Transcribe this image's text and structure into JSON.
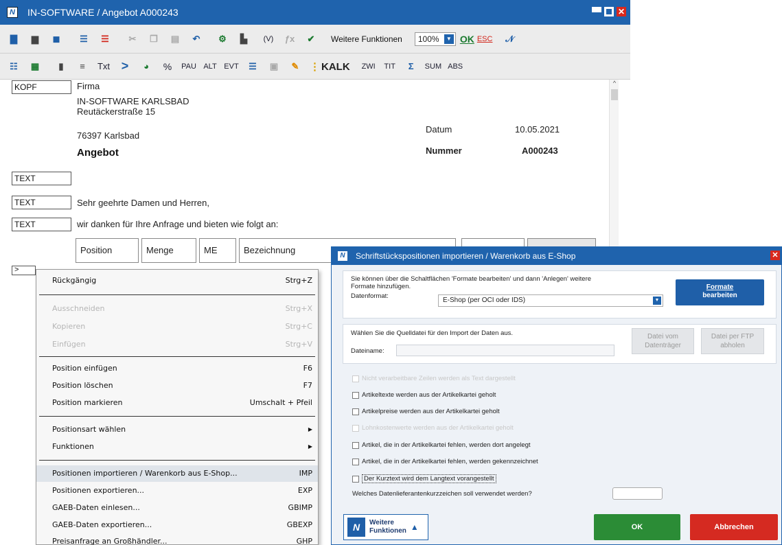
{
  "window": {
    "title": "IN-SOFTWARE / Angebot A000243",
    "icon": "app-logo-icon"
  },
  "toolbar1": {
    "weitere_funktionen": "Weitere Funktionen",
    "zoom": "100%",
    "ok": "OK",
    "esc": "ESC",
    "v_label": "(V)"
  },
  "toolbar2": {
    "txt": "Txt",
    "gt": ">",
    "percent": "%",
    "pau": "PAU",
    "alt": "ALT",
    "evt": "EVT",
    "kalk": "KALK",
    "zwi": "ZWI",
    "tit": "TIT",
    "sum": "SUM",
    "abs": "ABS"
  },
  "document": {
    "kopf_label": "KOPF",
    "firma": "Firma",
    "company": "IN-SOFTWARE KARLSBAD",
    "street": "Reutäckerstraße 15",
    "city": "76397 Karlsbad",
    "datum_label": "Datum",
    "datum_value": "10.05.2021",
    "title": "Angebot",
    "nummer_label": "Nummer",
    "nummer_value": "A000243",
    "text_label": "TEXT",
    "greeting": "Sehr geehrte Damen und Herren,",
    "intro": "wir danken für Ihre Anfrage und bieten wie folgt an:",
    "columns": [
      "Position",
      "Menge",
      "ME",
      "Bezeichnung"
    ],
    "pos_marker": ">"
  },
  "context_menu": {
    "items": [
      {
        "label": "Rückgängig",
        "shortcut": "Strg+Z",
        "disabled": false
      },
      {
        "label": "Ausschneiden",
        "shortcut": "Strg+X",
        "disabled": true
      },
      {
        "label": "Kopieren",
        "shortcut": "Strg+C",
        "disabled": true
      },
      {
        "label": "Einfügen",
        "shortcut": "Strg+V",
        "disabled": true
      },
      {
        "label": "Position einfügen",
        "shortcut": "F6",
        "disabled": false
      },
      {
        "label": "Position löschen",
        "shortcut": "F7",
        "disabled": false
      },
      {
        "label": "Position markieren",
        "shortcut": "Umschalt + Pfeil",
        "disabled": false
      },
      {
        "label": "Positionsart wählen",
        "shortcut": "",
        "disabled": false
      },
      {
        "label": "Funktionen",
        "shortcut": "",
        "disabled": false
      },
      {
        "label": "Positionen importieren / Warenkorb aus E-Shop...",
        "shortcut": "IMP",
        "disabled": false
      },
      {
        "label": "Positionen exportieren...",
        "shortcut": "EXP",
        "disabled": false
      },
      {
        "label": "GAEB-Daten einlesen...",
        "shortcut": "GBIMP",
        "disabled": false
      },
      {
        "label": "GAEB-Daten exportieren...",
        "shortcut": "GBEXP",
        "disabled": false
      },
      {
        "label": "Preisanfrage an Großhändler...",
        "shortcut": "GHP",
        "disabled": false
      }
    ]
  },
  "dialog": {
    "title": "Schriftstückspositionen importieren / Warenkorb aus E-Shop",
    "intro_line1": "Sie können über die Schaltflächen 'Formate bearbeiten' und dann 'Anlegen' weitere",
    "intro_line2": "Formate hinzufügen.",
    "datenformat_label": "Datenformat:",
    "datenformat_value": "E-Shop (per OCI oder IDS)",
    "formate_btn_line1": "Formate",
    "formate_btn_line2": "bearbeiten",
    "quelldatei_text": "Wählen Sie die Quelldatei für den Import der Daten aus.",
    "dateiname_label": "Dateiname:",
    "btn_datentraeger_line1": "Datei vom",
    "btn_datentraeger_line2": "Datenträger",
    "btn_ftp_line1": "Datei per FTP",
    "btn_ftp_line2": "abholen",
    "checkboxes": [
      {
        "label": "Nicht verarbeitbare Zeilen werden als Text dargestellt",
        "disabled": true
      },
      {
        "label": "Artikeltexte werden aus der Artikelkartei geholt",
        "disabled": false
      },
      {
        "label": "Artikelpreise werden aus der Artikelkartei geholt",
        "disabled": false
      },
      {
        "label": "Lohnkostenwerte werden aus der Artikelkartei geholt",
        "disabled": true
      },
      {
        "label": "Artikel, die in der Artikelkartei fehlen, werden dort angelegt",
        "disabled": false
      },
      {
        "label": "Artikel, die in der Artikelkartei fehlen, werden gekennzeichnet",
        "disabled": false
      },
      {
        "label": "Der Kurztext wird dem Langtext vorangestellt",
        "disabled": false
      }
    ],
    "kurzzeichen_question": "Welches Datenlieferantenkurzzeichen soll verwendet werden?",
    "weitere_line1": "Weitere",
    "weitere_line2": "Funktionen",
    "ok": "OK",
    "cancel": "Abbrechen"
  }
}
